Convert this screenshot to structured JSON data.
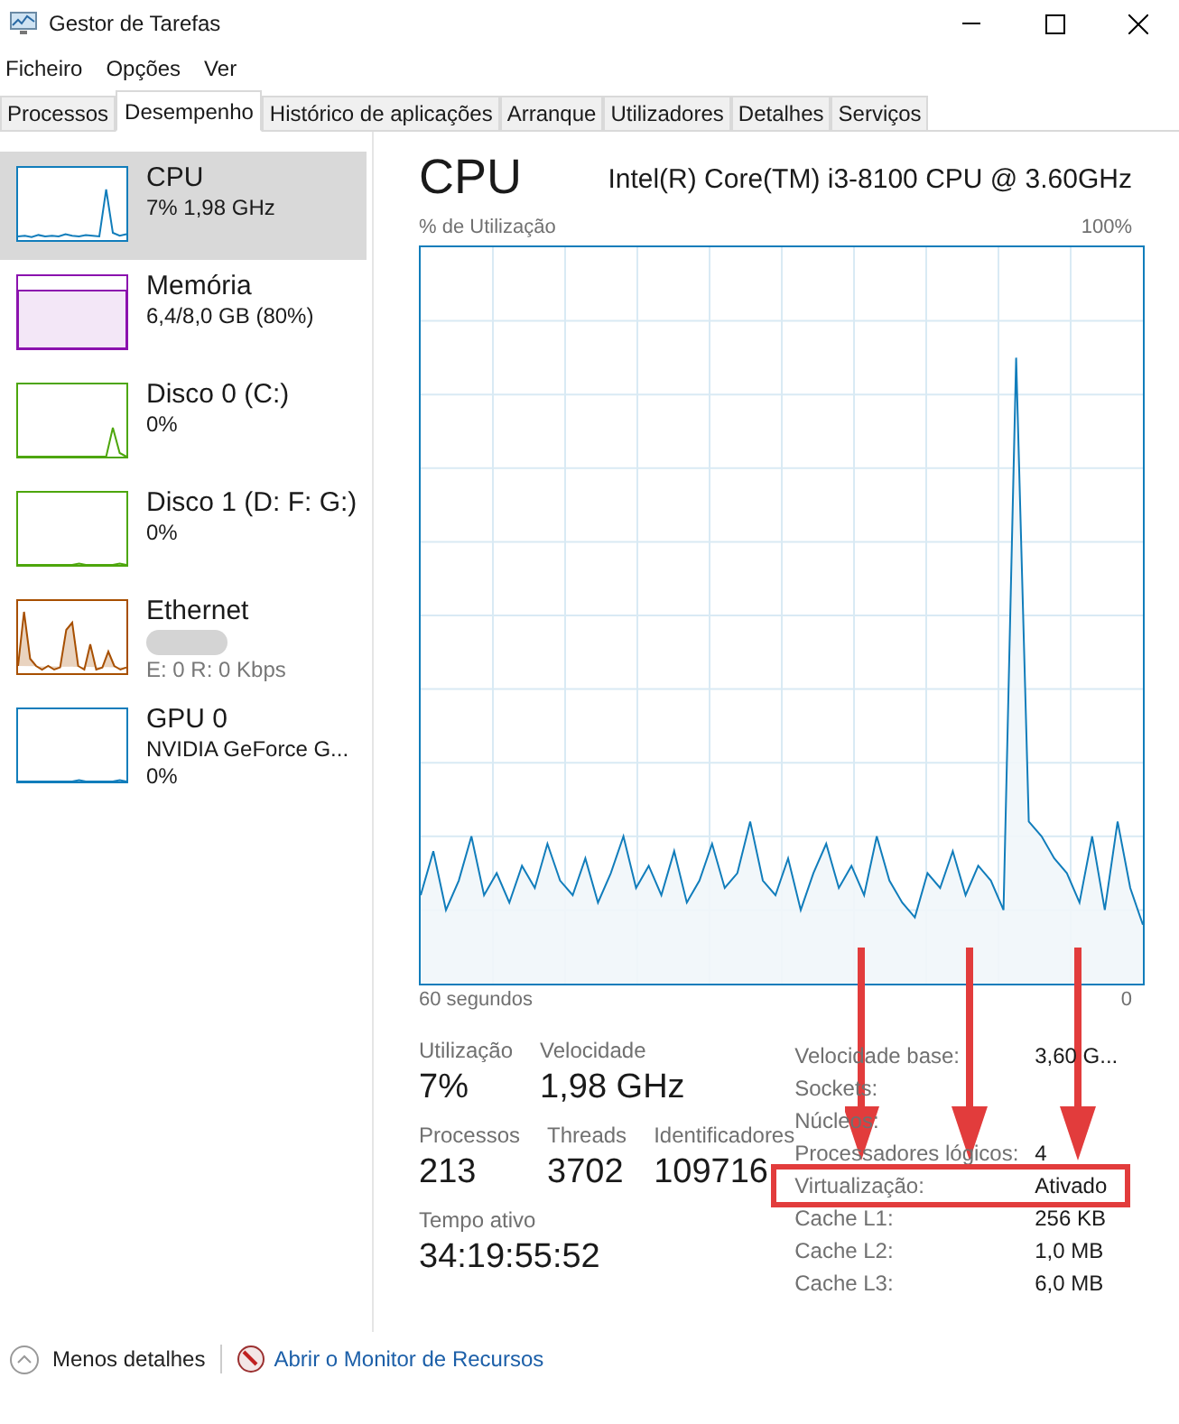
{
  "window": {
    "title": "Gestor de Tarefas"
  },
  "menu": [
    "Ficheiro",
    "Opções",
    "Ver"
  ],
  "tabs": [
    {
      "label": "Processos",
      "selected": false
    },
    {
      "label": "Desempenho",
      "selected": true
    },
    {
      "label": "Histórico de aplicações",
      "selected": false
    },
    {
      "label": "Arranque",
      "selected": false
    },
    {
      "label": "Utilizadores",
      "selected": false
    },
    {
      "label": "Detalhes",
      "selected": false
    },
    {
      "label": "Serviços",
      "selected": false
    }
  ],
  "sidebar": {
    "items": [
      {
        "name": "CPU",
        "lines": [
          "7% 1,98 GHz"
        ],
        "color": "#117dbb",
        "kind": "spike",
        "selected": true
      },
      {
        "name": "Memória",
        "lines": [
          "6,4/8,0 GB (80%)"
        ],
        "color": "#8b12ae",
        "kind": "fill",
        "selected": false
      },
      {
        "name": "Disco 0 (C:)",
        "lines": [
          "0%"
        ],
        "color": "#4da60c",
        "kind": "blip",
        "selected": false
      },
      {
        "name": "Disco 1 (D: F: G:)",
        "lines": [
          "0%"
        ],
        "color": "#4da60c",
        "kind": "flat",
        "selected": false
      },
      {
        "name": "Ethernet",
        "lines": [
          "E: 0 R: 0 Kbps"
        ],
        "color": "#a74f01",
        "kind": "bursts",
        "redacted": true,
        "selected": false
      },
      {
        "name": "GPU 0",
        "lines": [
          "NVIDIA GeForce G...",
          "0%"
        ],
        "color": "#117dbb",
        "kind": "flat",
        "selected": false
      }
    ]
  },
  "main": {
    "title": "CPU",
    "model": "Intel(R) Core(TM) i3-8100 CPU @ 3.60GHz",
    "y_label": "% de Utilização",
    "y_max": "100%",
    "x_label": "60 segundos",
    "x_min": "0",
    "stats": [
      [
        {
          "label": "Utilização",
          "value": "7%"
        },
        {
          "label": "Velocidade",
          "value": "1,98 GHz"
        }
      ],
      [
        {
          "label": "Processos",
          "value": "213"
        },
        {
          "label": "Threads",
          "value": "3702"
        },
        {
          "label": "Identificadores",
          "value": "109716"
        }
      ],
      [
        {
          "label": "Tempo ativo",
          "value": "34:19:55:52"
        }
      ]
    ],
    "specs": [
      {
        "label": "Velocidade base:",
        "value": "3,60 G..."
      },
      {
        "label": "Sockets:"
      },
      {
        "label": "Núcleos:"
      },
      {
        "label": "Processadores lógicos:",
        "value": "4"
      },
      {
        "label": "Virtualização:",
        "value": "Ativado",
        "highlighted": true
      },
      {
        "label": "Cache L1:",
        "value": "256 KB"
      },
      {
        "label": "Cache L2:",
        "value": "1,0 MB"
      },
      {
        "label": "Cache L3:",
        "value": "6,0 MB"
      }
    ]
  },
  "footer": {
    "less": "Menos detalhes",
    "link": "Abrir o Monitor de Recursos"
  }
}
